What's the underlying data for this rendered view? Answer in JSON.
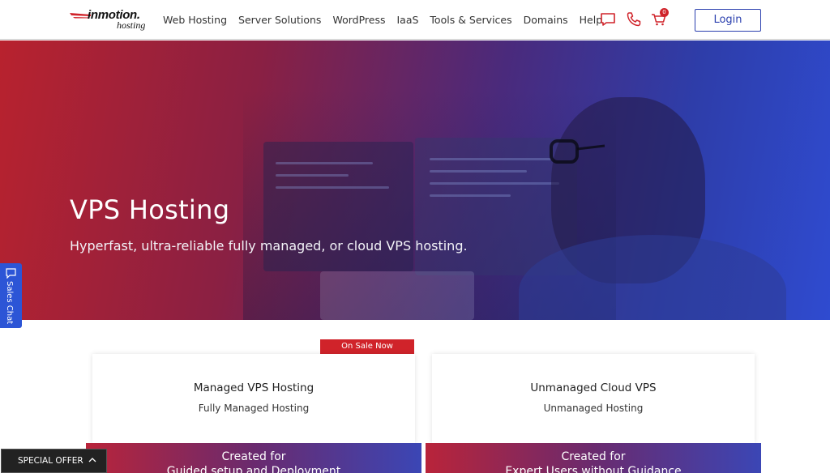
{
  "brand": {
    "name": "inmotion.",
    "sub": "hosting"
  },
  "nav": {
    "items": [
      "Web Hosting",
      "Server Solutions",
      "WordPress",
      "IaaS",
      "Tools & Services",
      "Domains",
      "Help"
    ]
  },
  "header": {
    "cart_count": "0",
    "login_label": "Login"
  },
  "icons": {
    "chat": "chat-icon",
    "phone": "phone-icon",
    "cart": "cart-icon"
  },
  "colors": {
    "brand_red": "#d0232a",
    "brand_blue": "#2a3fae"
  },
  "hero": {
    "title": "VPS Hosting",
    "subtitle": "Hyperfast, ultra-reliable fully managed, or cloud VPS hosting."
  },
  "sales_chat": {
    "label": "Sales Chat"
  },
  "plans": [
    {
      "badge": "On Sale Now",
      "title": "Managed VPS Hosting",
      "subtitle": "Fully Managed Hosting",
      "footer_line1": "Created for",
      "footer_line2": "Guided setup and Deployment"
    },
    {
      "badge": "",
      "title": "Unmanaged Cloud VPS",
      "subtitle": "Unmanaged Hosting",
      "footer_line1": "Created for",
      "footer_line2": "Expert Users without Guidance"
    }
  ],
  "special_offer": {
    "label": "SPECIAL OFFER"
  }
}
